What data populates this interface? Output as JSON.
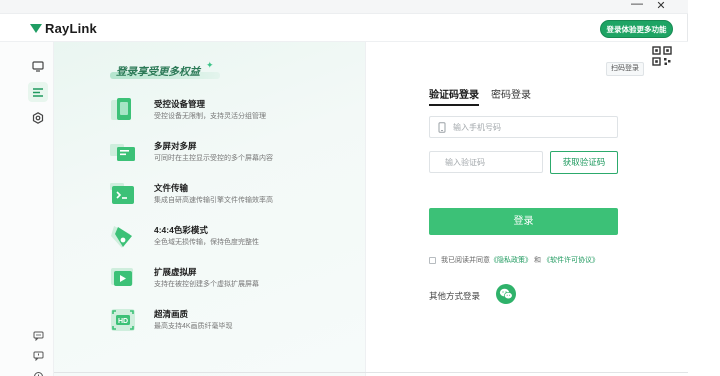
{
  "window": {
    "minimize_glyph": "—",
    "close_glyph": "✕"
  },
  "header": {
    "app_name": "RayLink",
    "promo_label": "登录体验更多功能"
  },
  "nav": {
    "items": [
      {
        "icon": "monitor-icon",
        "active": false
      },
      {
        "icon": "list-icon",
        "active": true
      },
      {
        "icon": "settings-icon",
        "active": false
      },
      {
        "icon": "chat-icon",
        "active": false
      },
      {
        "icon": "feedback-icon",
        "active": false
      },
      {
        "icon": "more-icon",
        "active": false
      }
    ]
  },
  "features": {
    "heading": "登录享受更多权益",
    "items": [
      {
        "icon": "device-management-icon",
        "title": "受控设备管理",
        "desc": "受控设备无限制，支持灵活分组管理"
      },
      {
        "icon": "multi-screen-icon",
        "title": "多屏对多屏",
        "desc": "可同时在主控显示受控的多个屏幕内容"
      },
      {
        "icon": "file-transfer-icon",
        "title": "文件传输",
        "desc": "集成自研高速传输引擎文件传输效率高"
      },
      {
        "icon": "color-mode-icon",
        "title": "4:4:4色彩模式",
        "desc": "全色域无损传输，保持色度完整性"
      },
      {
        "icon": "virtual-screen-icon",
        "title": "扩展虚拟屏",
        "desc": "支持在被控创建多个虚拟扩展屏幕"
      },
      {
        "icon": "hd-icon",
        "title": "超清画质",
        "desc": "最高支持4K画质纤毫毕现"
      }
    ]
  },
  "login": {
    "qr_label": "扫码登录",
    "tabs": [
      {
        "label": "验证码登录",
        "active": true
      },
      {
        "label": "密码登录",
        "active": false
      }
    ],
    "phone_placeholder": "输入手机号码",
    "code_placeholder": "输入验证码",
    "get_code_label": "获取验证码",
    "submit_label": "登录",
    "agree_prefix": "我已阅读并同意",
    "privacy_link": "《隐私政策》",
    "agree_and": "和",
    "license_link": "《软件许可协议》",
    "other_methods_label": "其他方式登录",
    "colors": {
      "accent": "#3cc177",
      "link": "#1f9a5f"
    }
  }
}
